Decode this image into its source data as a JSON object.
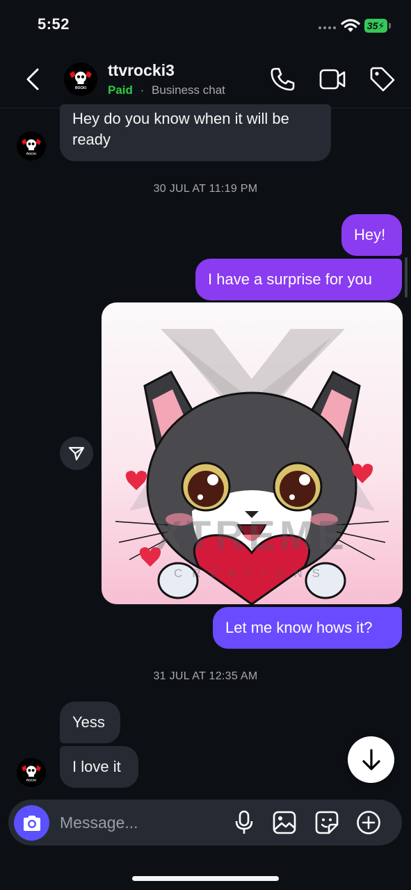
{
  "status_bar": {
    "time": "5:52",
    "battery": "35"
  },
  "header": {
    "contact_name": "ttvrocki3",
    "status_label": "Paid",
    "separator": "·",
    "chat_type": "Business chat"
  },
  "avatar_text": "ROCKI",
  "messages": {
    "incoming_1": "Hey do you know when it will be ready",
    "timestamp_1": "30 JUL AT 11:19 PM",
    "outgoing_1": "Hey!",
    "outgoing_2": "I have a surprise for you",
    "sticker_watermark": "XTREME",
    "sticker_watermark_sub": "CREATIONS",
    "outgoing_3": "Let me know hows it?",
    "timestamp_2": "31 JUL AT 12:35 AM",
    "incoming_2": "Yess",
    "incoming_3": "I love it"
  },
  "composer": {
    "placeholder": "Message..."
  },
  "colors": {
    "background": "#0c1014",
    "incoming_bubble": "#262b33",
    "outgoing_purple": "#8a3cf0",
    "outgoing_violet": "#6a4bff",
    "paid_green": "#2ecc40",
    "camera_button": "#5b51ff"
  },
  "icons": [
    "back-arrow-icon",
    "phone-icon",
    "video-icon",
    "tag-icon",
    "share-icon",
    "arrow-down-icon",
    "camera-icon",
    "microphone-icon",
    "gallery-icon",
    "sticker-icon",
    "plus-icon"
  ]
}
